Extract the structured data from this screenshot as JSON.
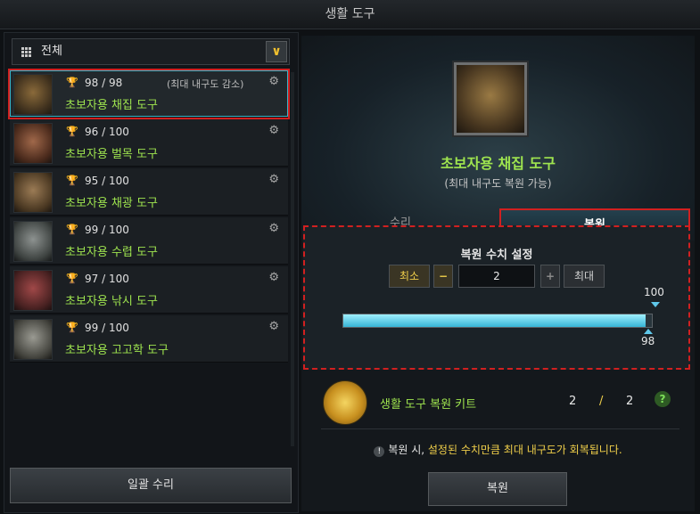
{
  "window": {
    "title": "생활 도구"
  },
  "filter": {
    "label": "전체",
    "dropdown_icon": "chevron-down-icon"
  },
  "items": [
    {
      "durability": "98 / 98",
      "note": "(최대 내구도 감소)",
      "name": "초보자용 채집 도구",
      "icon": "gathering-glove-icon"
    },
    {
      "durability": "96 / 100",
      "note": "",
      "name": "초보자용 벌목 도구",
      "icon": "axe-icon"
    },
    {
      "durability": "95 / 100",
      "note": "",
      "name": "초보자용 채광 도구",
      "icon": "pickaxe-icon"
    },
    {
      "durability": "99 / 100",
      "note": "",
      "name": "초보자용 수렵 도구",
      "icon": "hunting-blade-icon"
    },
    {
      "durability": "97 / 100",
      "note": "",
      "name": "초보자용 낚시 도구",
      "icon": "fishing-rod-icon"
    },
    {
      "durability": "99 / 100",
      "note": "",
      "name": "초보자용 고고학 도구",
      "icon": "shovel-icon"
    }
  ],
  "bulk_repair": {
    "label": "일괄 수리"
  },
  "preview": {
    "name": "초보자용 채집 도구",
    "subtitle": "(최대 내구도 복원 가능)"
  },
  "tabs": {
    "repair": "수리",
    "restore": "복원"
  },
  "restore_panel": {
    "title": "복원 수치 설정",
    "min_label": "최소",
    "minus_label": "−",
    "value": "2",
    "plus_label": "+",
    "max_label": "최대",
    "max_marker": "100",
    "current_marker": "98",
    "fill_fraction": 0.98
  },
  "kit": {
    "name": "생활 도구 복원 키트",
    "have": "2",
    "slash": "/",
    "need": "2",
    "help": "?"
  },
  "notice": {
    "part1": "복원 시, ",
    "part2": "설정된 수치만큼 최대 내구도가 회복됩니다."
  },
  "restore_button": {
    "label": "복원"
  },
  "colors": {
    "accent_green": "#9fe54f",
    "highlight_red": "#d12020",
    "gold": "#f0cf4a",
    "bar_cyan": "#36b4d4"
  }
}
